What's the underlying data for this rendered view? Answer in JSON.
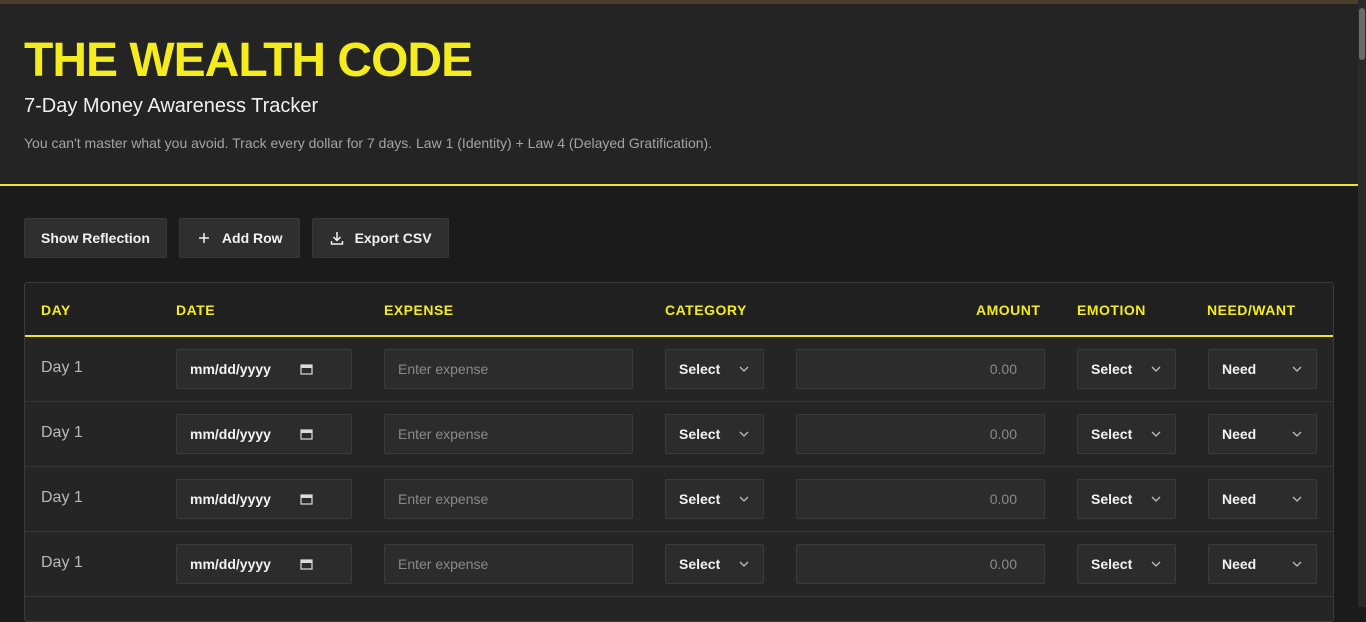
{
  "header": {
    "title": "THE WEALTH CODE",
    "subtitle": "7-Day Money Awareness Tracker",
    "description": "You can't master what you avoid. Track every dollar for 7 days. Law 1 (Identity) + Law 4 (Delayed Gratification)."
  },
  "toolbar": {
    "show_reflection": "Show Reflection",
    "add_row": "Add Row",
    "export_csv": "Export CSV",
    "icons": [
      "plus-icon",
      "download-icon"
    ]
  },
  "table": {
    "columns": [
      "DAY",
      "DATE",
      "EXPENSE",
      "CATEGORY",
      "AMOUNT",
      "EMOTION",
      "NEED/WANT"
    ],
    "rows": [
      {
        "day": "Day 1",
        "date": "mm/dd/yyyy",
        "expense_placeholder": "Enter expense",
        "category": "Select",
        "amount": "0.00",
        "emotion": "Select",
        "need_want": "Need"
      },
      {
        "day": "Day 1",
        "date": "mm/dd/yyyy",
        "expense_placeholder": "Enter expense",
        "category": "Select",
        "amount": "0.00",
        "emotion": "Select",
        "need_want": "Need"
      },
      {
        "day": "Day 1",
        "date": "mm/dd/yyyy",
        "expense_placeholder": "Enter expense",
        "category": "Select",
        "amount": "0.00",
        "emotion": "Select",
        "need_want": "Need"
      },
      {
        "day": "Day 1",
        "date": "mm/dd/yyyy",
        "expense_placeholder": "Enter expense",
        "category": "Select",
        "amount": "0.00",
        "emotion": "Select",
        "need_want": "Need"
      }
    ]
  },
  "colors": {
    "accent": "#f4ec1d",
    "background": "#1b1b1b",
    "header_background": "#242424"
  }
}
